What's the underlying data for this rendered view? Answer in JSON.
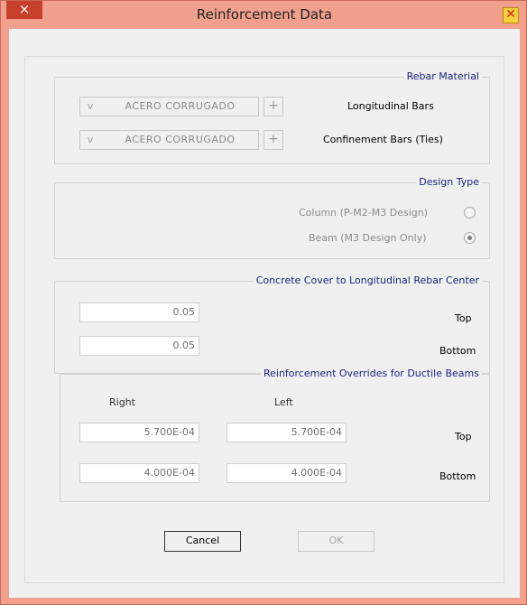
{
  "window": {
    "title": "Reinforcement Data",
    "close_glyph": "×",
    "icon": "app-icon"
  },
  "rebar_material": {
    "legend": "Rebar Material",
    "longitudinal": {
      "label": "Longitudinal Bars",
      "value": "ACERO CORRUGADO"
    },
    "confinement": {
      "label": "Confinement Bars  (Ties)",
      "value": "ACERO CORRUGADO"
    },
    "plus_glyph": "+",
    "arrow_glyph": "v"
  },
  "design_type": {
    "legend": "Design Type",
    "options": [
      {
        "label": "Column  (P-M2-M3 Design)",
        "selected": false
      },
      {
        "label": "Beam  (M3 Design Only)",
        "selected": true
      }
    ]
  },
  "concrete_cover": {
    "legend": "Concrete Cover to Longitudinal Rebar Center",
    "top": {
      "label": "Top",
      "value": "0.05"
    },
    "bottom": {
      "label": "Bottom",
      "value": "0.05"
    }
  },
  "overrides": {
    "legend": "Reinforcement Overrides for Ductile Beams",
    "col_left": "Left",
    "col_right": "Right",
    "top": {
      "label": "Top",
      "left": "5.700E-04",
      "right": "5.700E-04"
    },
    "bottom": {
      "label": "Bottom",
      "left": "4.000E-04",
      "right": "4.000E-04"
    }
  },
  "buttons": {
    "ok": "OK",
    "cancel": "Cancel"
  },
  "colors": {
    "frame": "#f2a08e",
    "close": "#c7402b",
    "legend_text": "#1a237e"
  }
}
